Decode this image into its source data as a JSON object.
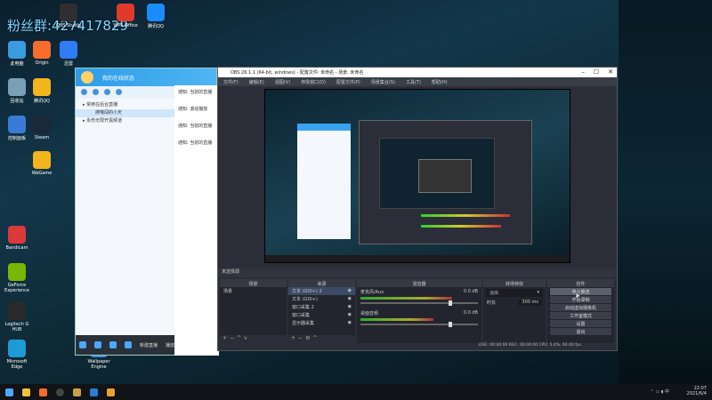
{
  "watermark": "粉丝群:427417829",
  "desktop_icons": [
    {
      "label": "OBS Studio",
      "color": "#302e31"
    },
    {
      "label": "WPS Office",
      "color": "#e23a2a"
    },
    {
      "label": "腾讯QQ",
      "color": "#1a8cff"
    },
    {
      "label": "此电脑",
      "color": "#3a9be0"
    },
    {
      "label": "Origin",
      "color": "#f56c2d"
    },
    {
      "label": "迅雷",
      "color": "#2f7cf6"
    },
    {
      "label": "回收站",
      "color": "#7aa0b8"
    },
    {
      "label": "Steam",
      "color": "#1b2838"
    },
    {
      "label": "WeGame",
      "color": "#f2b51c"
    },
    {
      "label": "控制面板",
      "color": "#3a7bd5"
    },
    {
      "label": "Bandicam",
      "color": "#d93a3a"
    },
    {
      "label": "GeForce Experience",
      "color": "#76b900"
    },
    {
      "label": "Logitech G HUB",
      "color": "#2a2a2a"
    },
    {
      "label": "Microsoft Edge",
      "color": "#1e9bd7"
    },
    {
      "label": "Wallpaper Engine",
      "color": "#3a8dde"
    }
  ],
  "qq": {
    "window_title": "我的在线状态",
    "group_1": "▸ 常用在后台直播",
    "item_1": "搜哦闯的小天",
    "group_2": "▸ 永伤无限开黑频道",
    "bottom_label_1": "新建直播",
    "bottom_label_2": "播放列表"
  },
  "chat": {
    "lines": [
      "通知: 当前的直播",
      "通知: 滚动播放",
      "通知: 当前的直播",
      "通知: 当前的直播"
    ]
  },
  "obs": {
    "title": "OBS 26.1.1 (64-bit, windows) - 配置文件: 未命名 - 场景: 未命名",
    "menu": [
      "文件(F)",
      "编辑(E)",
      "视图(V)",
      "停靠窗口(D)",
      "配置文件(P)",
      "场景集合(S)",
      "工具(T)",
      "帮助(H)"
    ],
    "studio_mode_label": "未选择源",
    "docks": {
      "scenes": "场景",
      "sources": "来源",
      "mixer": "混音器",
      "transitions": "转场特效",
      "controls": "控件"
    },
    "scene_items": [
      "场景"
    ],
    "source_items": [
      {
        "name": "文本 (GDI+) 2",
        "selected": true
      },
      {
        "name": "文本 (GDI+)",
        "selected": false
      },
      {
        "name": "窗口采集 2",
        "selected": false
      },
      {
        "name": "窗口采集",
        "selected": false
      },
      {
        "name": "显示器采集",
        "selected": false
      }
    ],
    "mixer_channels": [
      {
        "name": "麦克风/Aux",
        "db": "0.0 dB",
        "level": 0.78
      },
      {
        "name": "桌面音频",
        "db": "0.0 dB",
        "level": 0.62
      }
    ],
    "transition": "淡出",
    "duration_label": "时长",
    "duration": "300 ms",
    "controls": [
      {
        "label": "停止推流",
        "hot": true
      },
      {
        "label": "开始录制",
        "hot": false
      },
      {
        "label": "启动虚拟摄像机",
        "hot": false
      },
      {
        "label": "工作室模式",
        "hot": false
      },
      {
        "label": "设置",
        "hot": false
      },
      {
        "label": "退出",
        "hot": false
      }
    ],
    "status": "LIVE: 00:00:00   REC: 00:00:00   CPU: 5.4%, 60.00 fps"
  },
  "taskbar": {
    "time": "22:07",
    "date": "2021/6/4"
  }
}
